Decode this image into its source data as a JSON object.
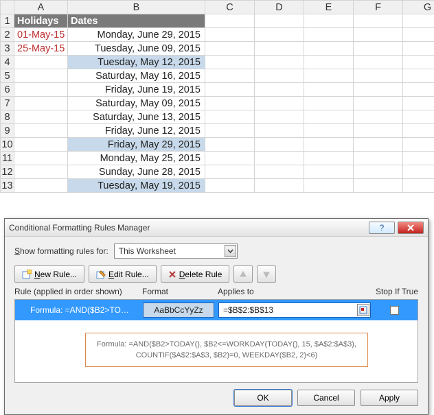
{
  "columns": [
    "A",
    "B",
    "C",
    "D",
    "E",
    "F",
    "G"
  ],
  "rows": [
    "1",
    "2",
    "3",
    "4",
    "5",
    "6",
    "7",
    "8",
    "9",
    "10",
    "11",
    "12",
    "13"
  ],
  "sheet": {
    "header": {
      "A": "Holidays",
      "B": "Dates"
    },
    "data": [
      {
        "A": "01-May-15",
        "B": "Monday, June 29, 2015",
        "hilite": false
      },
      {
        "A": "25-May-15",
        "B": "Tuesday, June 09, 2015",
        "hilite": false
      },
      {
        "A": "",
        "B": "Tuesday, May 12, 2015",
        "hilite": true
      },
      {
        "A": "",
        "B": "Saturday, May 16, 2015",
        "hilite": false
      },
      {
        "A": "",
        "B": "Friday, June 19, 2015",
        "hilite": false
      },
      {
        "A": "",
        "B": "Saturday, May 09, 2015",
        "hilite": false
      },
      {
        "A": "",
        "B": "Saturday, June 13, 2015",
        "hilite": false
      },
      {
        "A": "",
        "B": "Friday, June 12, 2015",
        "hilite": false
      },
      {
        "A": "",
        "B": "Friday, May 29, 2015",
        "hilite": true
      },
      {
        "A": "",
        "B": "Monday, May 25, 2015",
        "hilite": false
      },
      {
        "A": "",
        "B": "Sunday, June 28, 2015",
        "hilite": false
      },
      {
        "A": "",
        "B": "Tuesday, May 19, 2015",
        "hilite": true
      }
    ]
  },
  "dialog": {
    "title": "Conditional Formatting Rules Manager",
    "show_label_pre": "S",
    "show_label_post": "how formatting rules for:",
    "scope": "This Worksheet",
    "buttons": {
      "new": "New Rule...",
      "edit": "Edit Rule...",
      "delete": "Delete Rule"
    },
    "list_headers": {
      "rule": "Rule (applied in order shown)",
      "format": "Format",
      "applies": "Applies to",
      "stop": "Stop If True"
    },
    "rule": {
      "name": "Formula: =AND($B2>TO…",
      "preview": "AaBbCcYyZz",
      "applies_to": "=$B$2:$B$13",
      "stop": false
    },
    "formula_lines": [
      "Formula: =AND($B2>TODAY(), $B2<=WORKDAY(TODAY(), 15, $A$2:$A$3),",
      "COUNTIF($A$2:$A$3, $B2)=0, WEEKDAY($B2, 2)<6)"
    ],
    "footer": {
      "ok": "OK",
      "cancel": "Cancel",
      "apply": "Apply"
    }
  }
}
